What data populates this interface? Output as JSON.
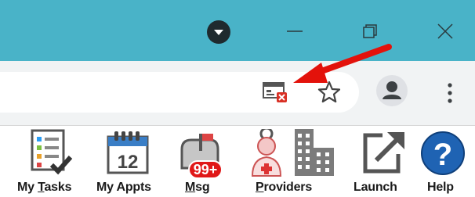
{
  "colors": {
    "titlebar": "#49b3c8",
    "toolbar": "#f1f3f4",
    "arrow": "#e3120b",
    "badge": "#e01818",
    "help_blue": "#1f63b3"
  },
  "window_controls": {
    "profile_icon": "profile-dropdown-icon",
    "minimize_icon": "minimize-icon",
    "restore_icon": "restore-icon",
    "close_icon": "close-icon"
  },
  "toolbar": {
    "site_control_icon": "blocked-popup-icon",
    "bookmark_icon": "star-icon",
    "account_icon": "account-icon",
    "menu_icon": "kebab-menu-icon",
    "annotation_icon": "red-arrow-icon"
  },
  "app_bar": {
    "items": [
      {
        "label_pre": "My ",
        "label_u": "T",
        "label_post": "asks",
        "icon": "task-list-icon"
      },
      {
        "label": "My Appts",
        "icon": "calendar-icon",
        "date": "12"
      },
      {
        "label_u": "M",
        "label_post": "sg",
        "icon": "mail-icon",
        "badge": "99+"
      },
      {
        "label_u": "P",
        "label_post": "roviders",
        "icon": "provider-icon"
      },
      {
        "label": "Launch",
        "icon": "external-launch-icon"
      },
      {
        "label": "Help",
        "icon": "help-icon",
        "glyph": "?"
      }
    ]
  }
}
